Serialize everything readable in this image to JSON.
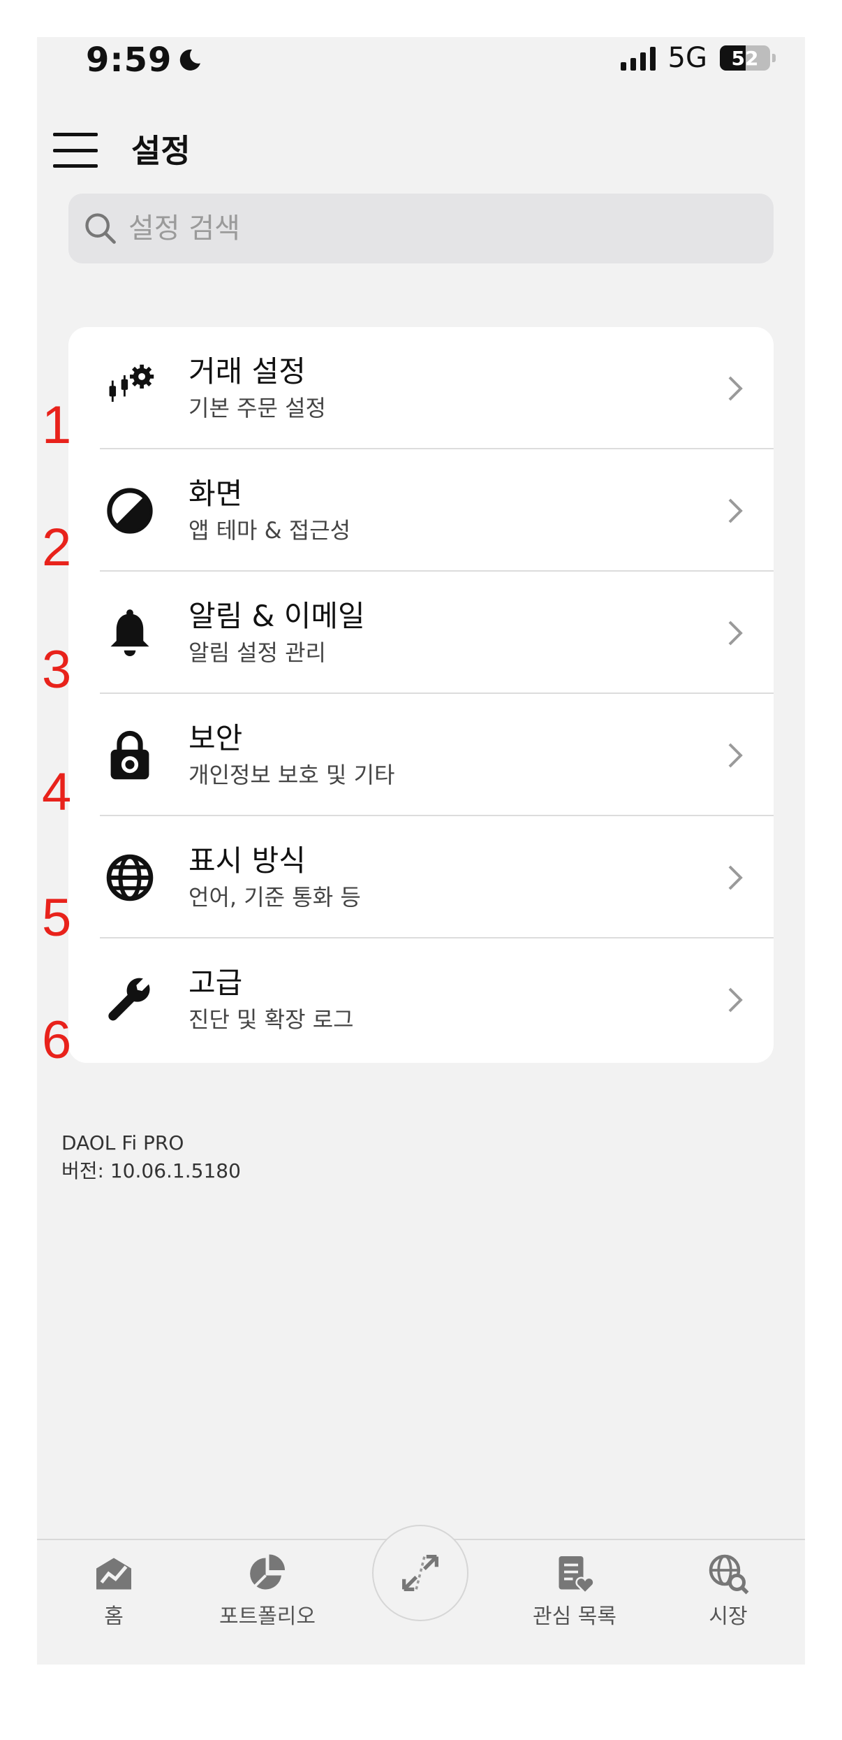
{
  "status_bar": {
    "time": "9:59",
    "network": "5G",
    "battery": "52",
    "battery_level": 0.52
  },
  "header": {
    "title": "설정"
  },
  "search": {
    "placeholder": "설정 검색"
  },
  "settings": [
    {
      "number": "1",
      "title": "거래 설정",
      "subtitle": "기본 주문 설정",
      "icon": "trading-gears-icon"
    },
    {
      "number": "2",
      "title": "화면",
      "subtitle": "앱 테마 & 접근성",
      "icon": "contrast-icon"
    },
    {
      "number": "3",
      "title": "알림 & 이메일",
      "subtitle": "알림 설정 관리",
      "icon": "bell-icon"
    },
    {
      "number": "4",
      "title": "보안",
      "subtitle": "개인정보 보호 및 기타",
      "icon": "lock-icon"
    },
    {
      "number": "5",
      "title": "표시 방식",
      "subtitle": "언어, 기준 통화 등",
      "icon": "globe-icon"
    },
    {
      "number": "6",
      "title": "고급",
      "subtitle": "진단 및 확장 로그",
      "icon": "wrench-icon"
    }
  ],
  "app_info": {
    "name": "DAOL Fi PRO",
    "version": "버전: 10.06.1.5180"
  },
  "tabbar": {
    "home": "홈",
    "portfolio": "포트폴리오",
    "watchlist": "관심 목록",
    "market": "시장"
  }
}
